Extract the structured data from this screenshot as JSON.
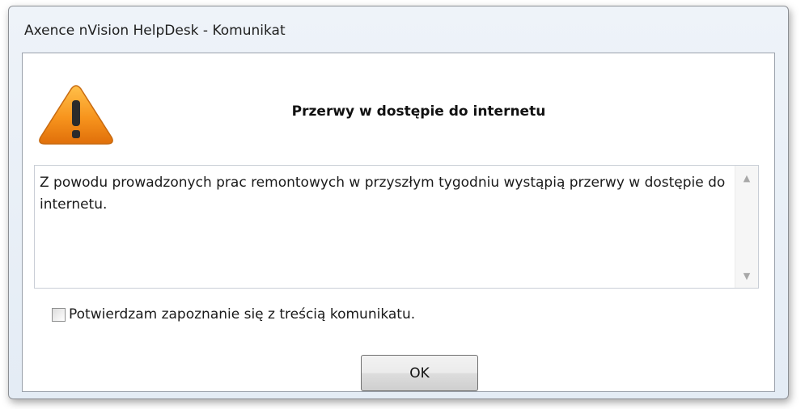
{
  "window": {
    "title": "Axence nVision HelpDesk - Komunikat"
  },
  "dialog": {
    "icon": "warning-icon",
    "heading": "Przerwy w dostępie do internetu",
    "message": "Z powodu prowadzonych prac remontowych w przyszłym tygodniu wystąpią przerwy w dostępie do internetu.",
    "checkbox_label": "Potwierdzam zapoznanie się z treścią komunikatu.",
    "checkbox_checked": false,
    "ok_label": "OK"
  },
  "colors": {
    "warning_orange": "#f7941d",
    "warning_dark": "#e06f0a"
  }
}
